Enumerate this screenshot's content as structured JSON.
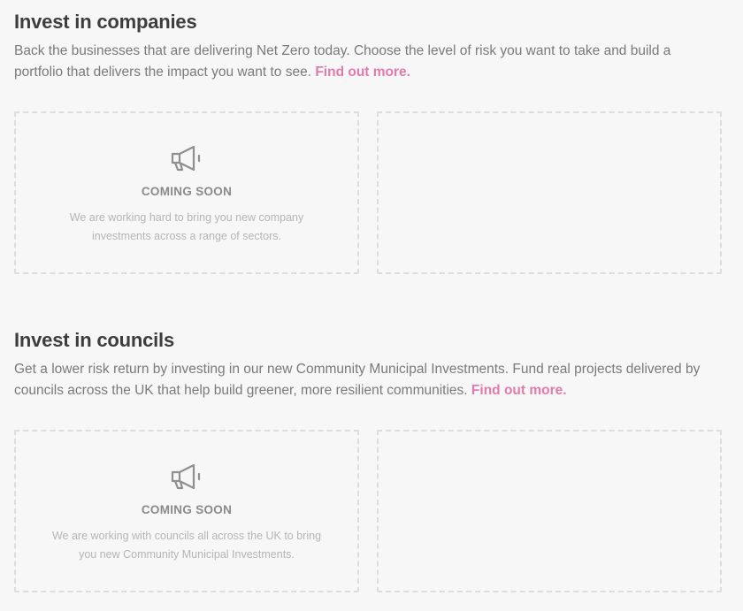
{
  "companies": {
    "title": "Invest in companies",
    "description": "Back the businesses that are delivering Net Zero today. Choose the level of risk you want to take and build a portfolio that delivers the impact you want to see.",
    "link_label": "Find out more.",
    "card": {
      "status": "COMING SOON",
      "text": "We are working hard to bring you new company investments across a range of sectors."
    }
  },
  "councils": {
    "title": "Invest in councils",
    "description": "Get a lower risk return by investing in our new Community Municipal Investments. Fund real projects delivered by councils across the UK that help build greener, more resilient communities.",
    "link_label": "Find out more.",
    "card": {
      "status": "COMING SOON",
      "text": "We are working with councils all across the UK to bring you new Community Municipal Investments."
    }
  },
  "colors": {
    "background": "#f7f7f7",
    "heading": "#3d3d3d",
    "body_text": "#7a7a7a",
    "link": "#e07bab",
    "card_border": "#dddddd",
    "muted_text": "#b5b5b5"
  },
  "icons": {
    "card_icon": "megaphone-icon"
  }
}
